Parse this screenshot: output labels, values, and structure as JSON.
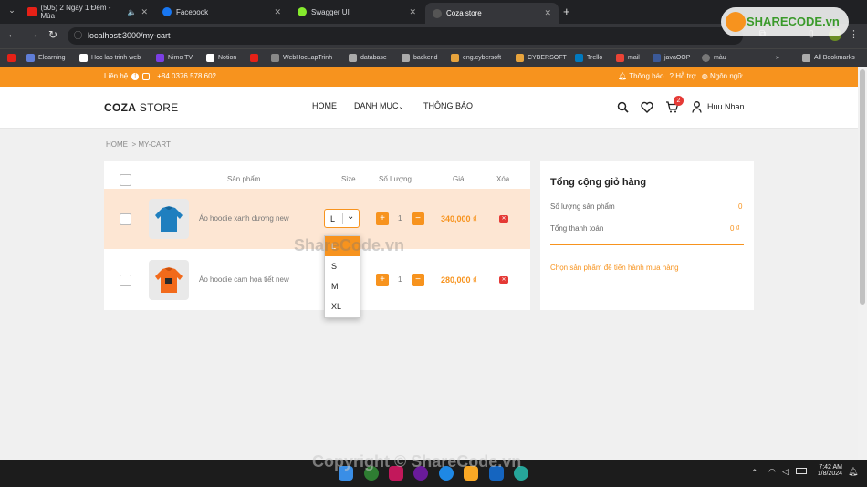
{
  "browser": {
    "tabs": [
      {
        "label": "(505) 2 Ngày 1 Đêm - Mùa"
      },
      {
        "label": "Facebook"
      },
      {
        "label": "Swagger UI"
      },
      {
        "label": "Coza store"
      }
    ],
    "url": "localhost:3000/my-cart",
    "bookmarks": [
      "Elearning",
      "Hoc lap trinh web",
      "Nimo TV",
      "Notion",
      "WebHocLapTrinh",
      "database",
      "backend",
      "eng.cybersoft",
      "CYBERSOFT",
      "Trello",
      "mail",
      "javaOOP",
      "màu"
    ],
    "all_bookmarks": "All Bookmarks",
    "new_tab": "+"
  },
  "topbar": {
    "contact": "Liên hệ",
    "phone": "+84 0376 578 602",
    "notify": "Thông báo",
    "support": "Hỗ trợ",
    "language": "Ngôn ngữ"
  },
  "header": {
    "logo_bold": "COZA",
    "logo_rest": " STORE",
    "nav": [
      "HOME",
      "DANH MỤC",
      "THÔNG BÁO"
    ],
    "cart_count": "2",
    "user": "Huu Nhan"
  },
  "breadcrumb": {
    "home": "HOME",
    "current": "> MY-CART"
  },
  "cart": {
    "columns": {
      "product": "Sản phẩm",
      "size": "Size",
      "qty": "Số Lượng",
      "price": "Giá",
      "delete": "Xóa"
    },
    "items": [
      {
        "name": "Áo hoodie xanh dương new",
        "size": "L",
        "qty": "1",
        "price": "340,000 ₫",
        "color": "#1f7fbf"
      },
      {
        "name": "Áo hoodie cam họa tiết new",
        "size": "",
        "qty": "1",
        "price": "280,000 ₫",
        "color": "#f26a1b"
      }
    ],
    "size_options": [
      "L",
      "S",
      "M",
      "XL"
    ],
    "minus": "−",
    "plus": "+"
  },
  "summary": {
    "title": "Tổng cộng giỏ hàng",
    "count_label": "Số lượng sản phẩm",
    "count_value": "0",
    "total_label": "Tổng thanh toán",
    "total_value": "0 ₫",
    "hint": "Chọn sản phẩm để tiến hành mua hàng"
  },
  "watermarks": {
    "center": "ShareCode.vn",
    "bottom": "Copyright © ShareCode.vn",
    "logo": "SHARECODE.vn"
  },
  "taskbar": {
    "time": "7:42 AM",
    "date": "1/8/2024"
  },
  "colors": {
    "accent": "#f7931e",
    "row_selected": "#fde6d3"
  }
}
